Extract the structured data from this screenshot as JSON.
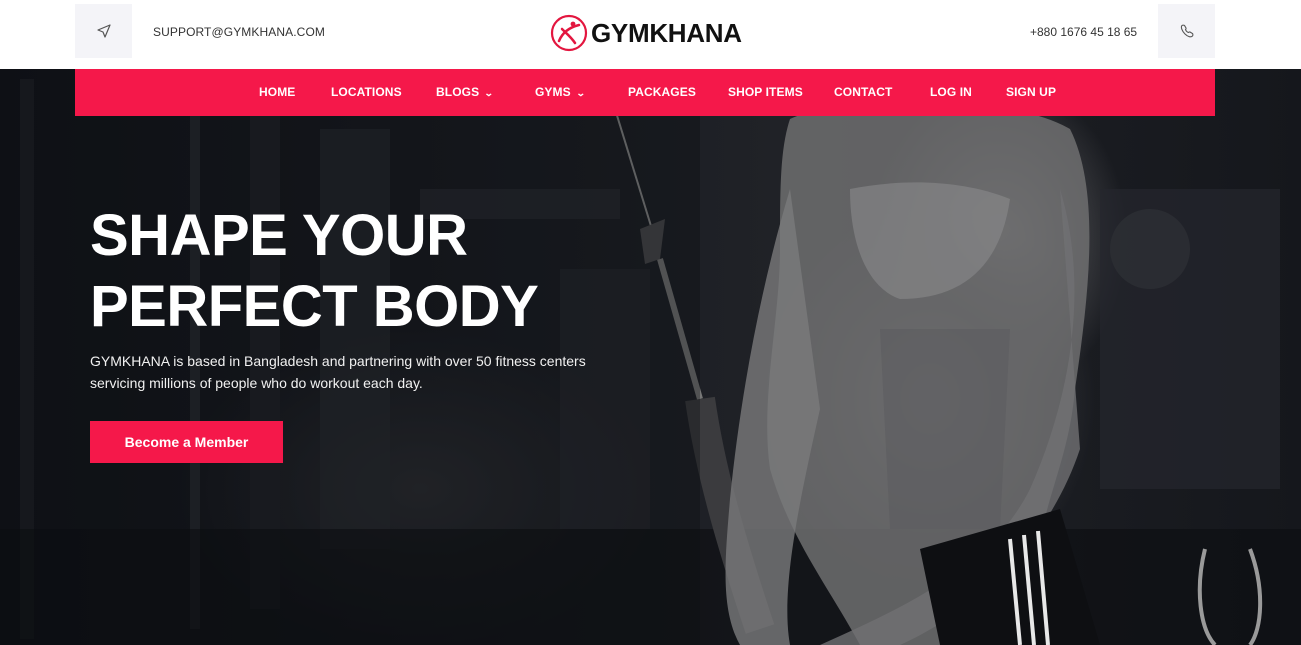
{
  "header": {
    "email": "SUPPORT@GYMKHANA.COM",
    "phone": "+880 1676 45 18 65",
    "logo_text": "GYMKHANA",
    "send_icon": "send-icon",
    "phone_icon": "phone-icon"
  },
  "nav": {
    "items": [
      {
        "label": "HOME",
        "dropdown": false
      },
      {
        "label": "LOCATIONS",
        "dropdown": false
      },
      {
        "label": "BLOGS",
        "dropdown": true
      },
      {
        "label": "GYMS",
        "dropdown": true
      },
      {
        "label": "PACKAGES",
        "dropdown": false
      },
      {
        "label": "SHOP ITEMS",
        "dropdown": false
      },
      {
        "label": "CONTACT",
        "dropdown": false
      },
      {
        "label": "LOG IN",
        "dropdown": false
      },
      {
        "label": "SIGN UP",
        "dropdown": false
      }
    ],
    "caret_icon": "chevron-down-icon"
  },
  "hero": {
    "title_line1": "SHAPE YOUR",
    "title_line2": "PERFECT BODY",
    "description_line1": "GYMKHANA is based in Bangladesh and partnering with over 50 fitness centers",
    "description_line2": "servicing millions of people who do workout each day.",
    "cta_label": "Become a Member"
  },
  "colors": {
    "accent": "#f5184a",
    "header_bg": "#ffffff",
    "text_dark": "#111111"
  }
}
